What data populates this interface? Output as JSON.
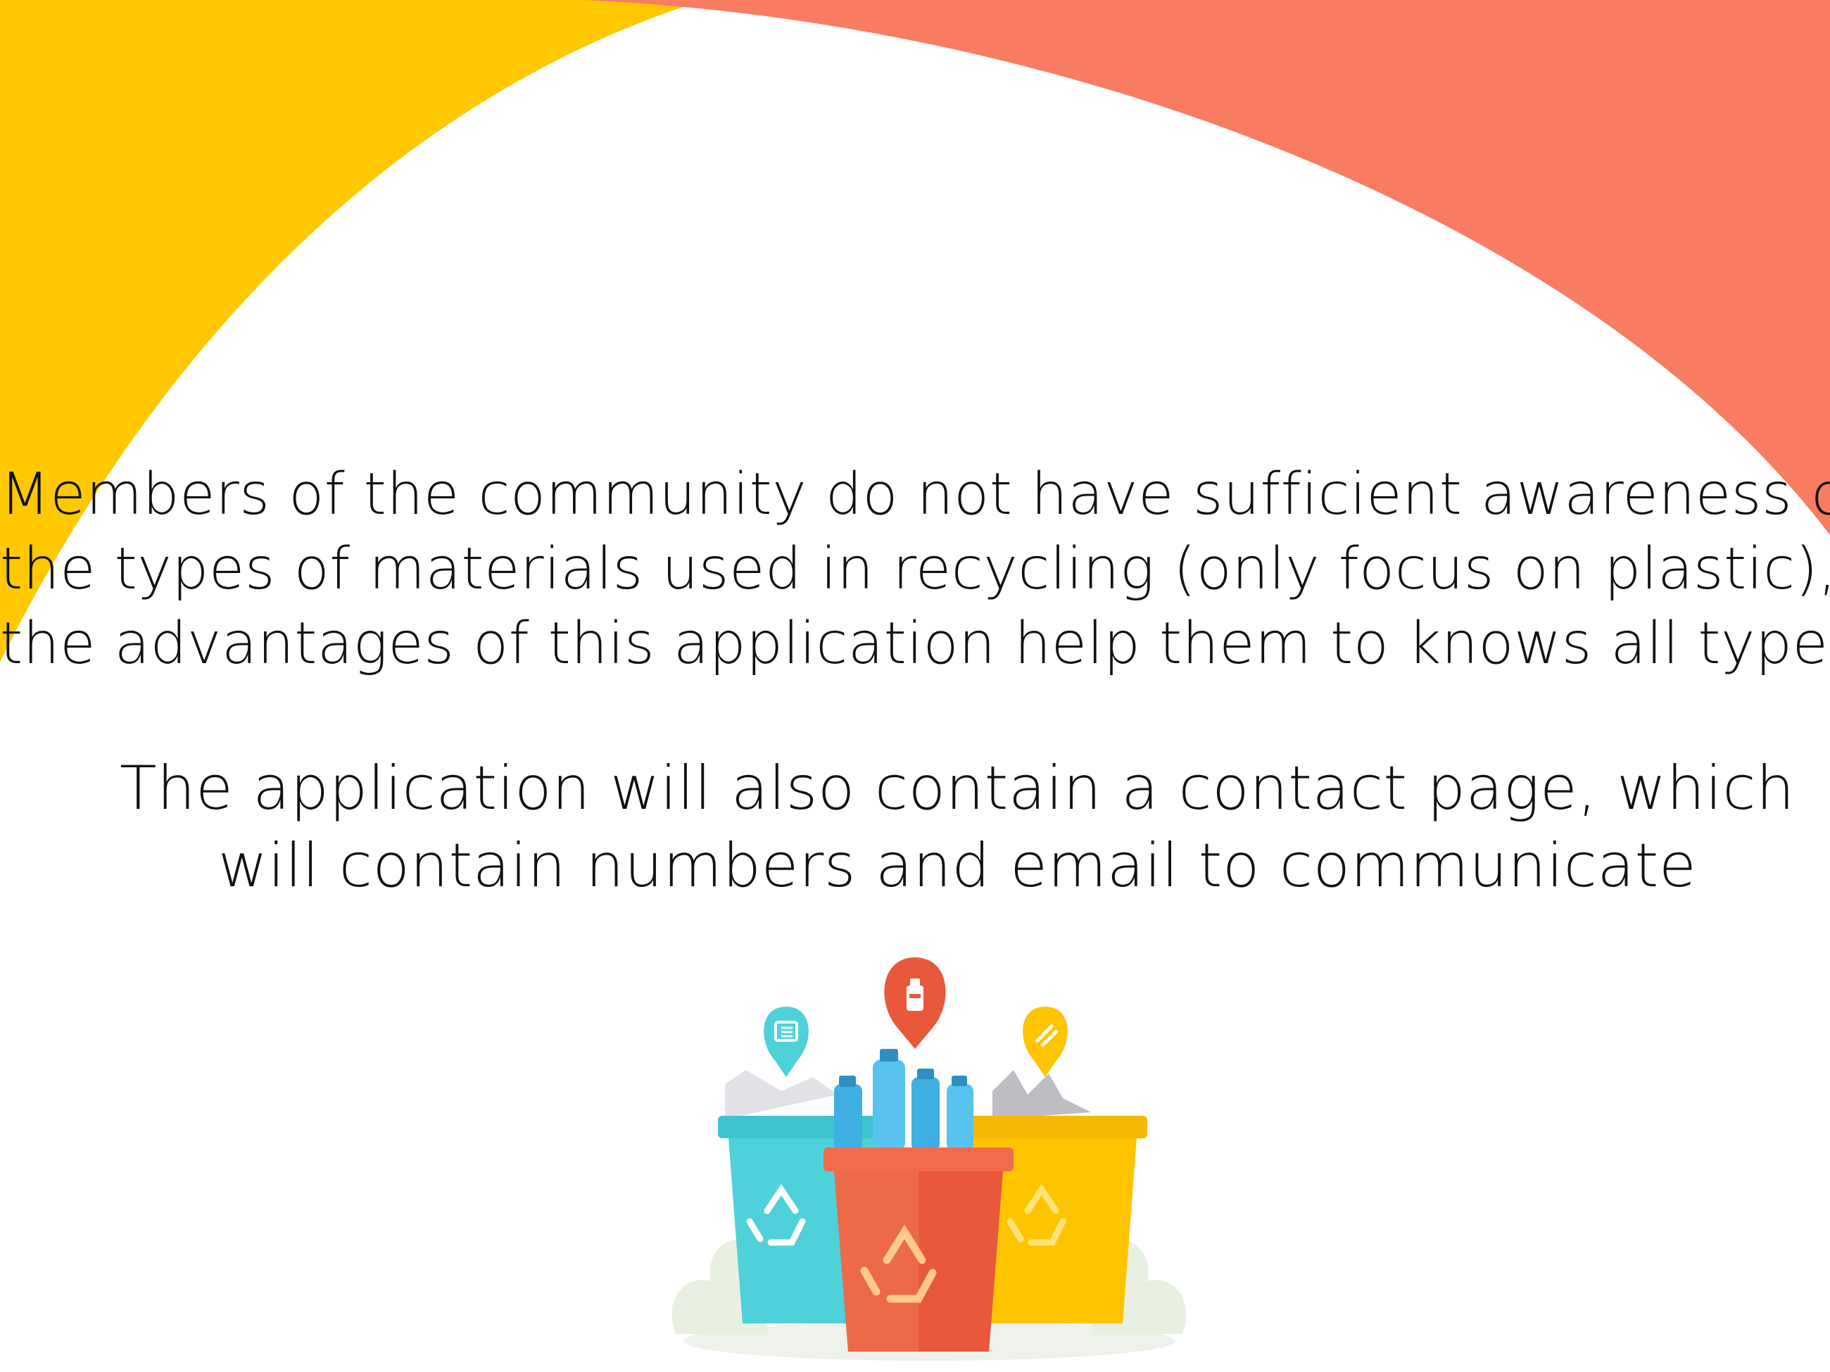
{
  "paragraph1": {
    "line1": "Members of the community do not have sufficient awareness of",
    "line2": "the types of materials used in recycling (only focus on plastic), so",
    "line3": "the advantages of this application help them to knows all types."
  },
  "paragraph2": {
    "line1": "The application will also contain a contact page, which",
    "line2": "will contain numbers and email to communicate"
  },
  "colors": {
    "yellow_arc": "#FFC800",
    "coral_arc": "#F87C62",
    "text": "#111111",
    "teal_bin": "#4FD1D9",
    "red_bin": "#E8583A",
    "yellow_bin": "#FFC400"
  },
  "illustration": {
    "icons": [
      "newspaper-pin-icon",
      "bottle-pin-icon",
      "metal-pin-icon",
      "recycle-icon"
    ]
  }
}
